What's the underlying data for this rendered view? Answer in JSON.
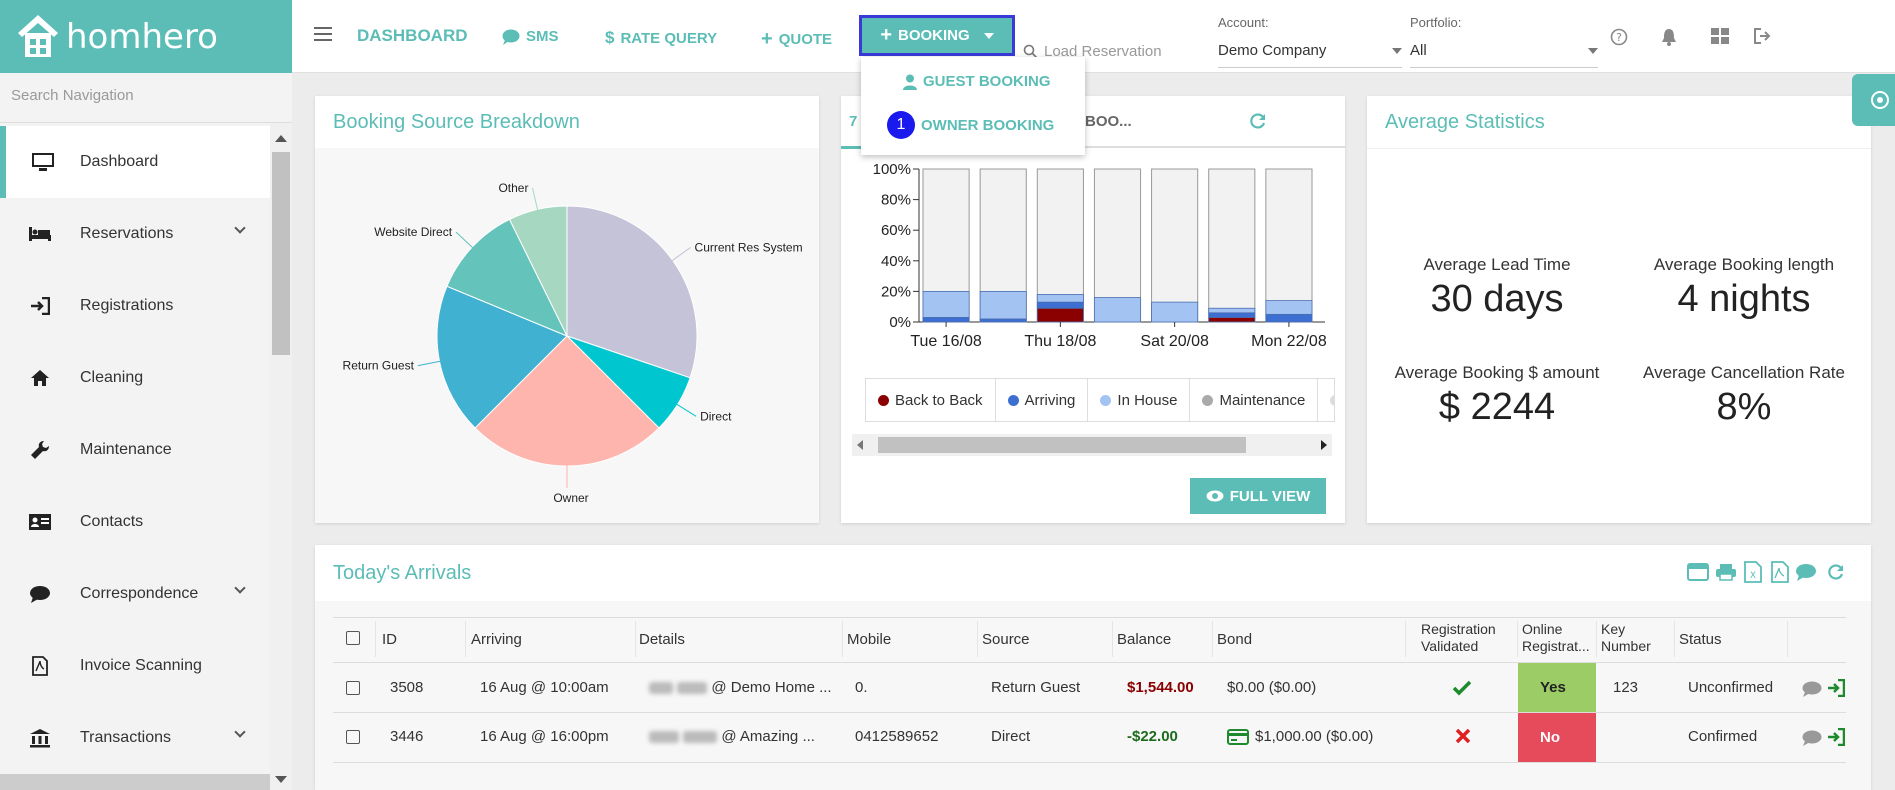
{
  "brand": {
    "name": "homhero"
  },
  "nav": {
    "dashboard": "DASHBOARD",
    "sms": "SMS",
    "rate_query": "RATE QUERY",
    "quote": "QUOTE",
    "booking": "BOOKING",
    "load_reservation_placeholder": "Load Reservation"
  },
  "booking_menu": {
    "guest": "GUEST BOOKING",
    "owner": "OWNER BOOKING",
    "badge": "1"
  },
  "account": {
    "label": "Account:",
    "value": "Demo Company"
  },
  "portfolio": {
    "label": "Portfolio:",
    "value": "All"
  },
  "sidebar": {
    "search_placeholder": "Search Navigation",
    "items": [
      {
        "label": "Dashboard",
        "icon": "monitor-icon"
      },
      {
        "label": "Reservations",
        "icon": "bed-icon"
      },
      {
        "label": "Registrations",
        "icon": "sign-in-icon"
      },
      {
        "label": "Cleaning",
        "icon": "home-icon"
      },
      {
        "label": "Maintenance",
        "icon": "wrench-icon"
      },
      {
        "label": "Contacts",
        "icon": "contact-card-icon"
      },
      {
        "label": "Correspondence",
        "icon": "chat-bubble-icon"
      },
      {
        "label": "Invoice Scanning",
        "icon": "pdf-file-icon"
      },
      {
        "label": "Transactions",
        "icon": "bank-icon"
      }
    ]
  },
  "booking_source": {
    "title": "Booking Source Breakdown",
    "chart_data": {
      "type": "pie",
      "slices": [
        {
          "label": "Current Res System",
          "value": 29,
          "color": "#c5c3d8"
        },
        {
          "label": "Direct",
          "value": 7,
          "color": "#00c6d0"
        },
        {
          "label": "Owner",
          "value": 24,
          "color": "#fdb5ad"
        },
        {
          "label": "Return Guest",
          "value": 18,
          "color": "#40b1d1"
        },
        {
          "label": "Website Direct",
          "value": 11,
          "color": "#64c3bb"
        },
        {
          "label": "Other",
          "value": 7,
          "color": "#a6d8c1"
        }
      ]
    }
  },
  "occupancy": {
    "tab_prefix": "7",
    "tab_label": "BOO...",
    "full_view": "FULL VIEW",
    "legend": [
      {
        "name": "Back to Back",
        "color": "#8b0000"
      },
      {
        "name": "Arriving",
        "color": "#3c6fd1"
      },
      {
        "name": "In House",
        "color": "#a3c4f3"
      },
      {
        "name": "Maintenance",
        "color": "#aaaaaa"
      }
    ],
    "chart_data": {
      "type": "bar",
      "stacked": true,
      "x_ticks": [
        "Tue 16/08",
        "Thu 18/08",
        "Sat 20/08",
        "Mon 22/08"
      ],
      "y_ticks": [
        "100%",
        "80%",
        "60%",
        "40%",
        "20%",
        "0%"
      ],
      "ylim": [
        0,
        100
      ],
      "series": [
        {
          "name": "Back to Back",
          "values": [
            0,
            0,
            9,
            0,
            0,
            3,
            0
          ]
        },
        {
          "name": "Arriving",
          "values": [
            3,
            2,
            4,
            0,
            0,
            3,
            5
          ]
        },
        {
          "name": "In House",
          "values": [
            17,
            18,
            5,
            16,
            13,
            3,
            9
          ]
        }
      ]
    }
  },
  "averages": {
    "title": "Average Statistics",
    "stats": [
      {
        "label": "Average Lead Time",
        "value": "30 days"
      },
      {
        "label": "Average Booking length",
        "value": "4 nights"
      },
      {
        "label": "Average Booking $ amount",
        "value": "$ 2244"
      },
      {
        "label": "Average Cancellation Rate",
        "value": "8%"
      }
    ]
  },
  "arrivals": {
    "title": "Today's Arrivals",
    "columns": {
      "id": "ID",
      "arriving": "Arriving",
      "details": "Details",
      "mobile": "Mobile",
      "source": "Source",
      "balance": "Balance",
      "bond": "Bond",
      "reg_validated_1": "Registration",
      "reg_validated_2": "Validated",
      "online_reg_1": "Online",
      "online_reg_2": "Registrat...",
      "key_1": "Key",
      "key_2": "Number",
      "status": "Status"
    },
    "rows": [
      {
        "id": "3508",
        "arriving": "16 Aug @ 10:00am",
        "details": "@ Demo Home ...",
        "mobile": "0.",
        "source": "Return Guest",
        "balance": "$1,544.00",
        "bond": "$0.00 ($0.00)",
        "online": "Yes",
        "key": "123",
        "status": "Unconfirmed"
      },
      {
        "id": "3446",
        "arriving": "16 Aug @ 16:00pm",
        "details": "@ Amazing ...",
        "mobile": "0412589652",
        "source": "Direct",
        "balance": "-$22.00",
        "bond": "$1,000.00 ($0.00)",
        "online": "No",
        "key": "",
        "status": "Confirmed"
      }
    ]
  }
}
